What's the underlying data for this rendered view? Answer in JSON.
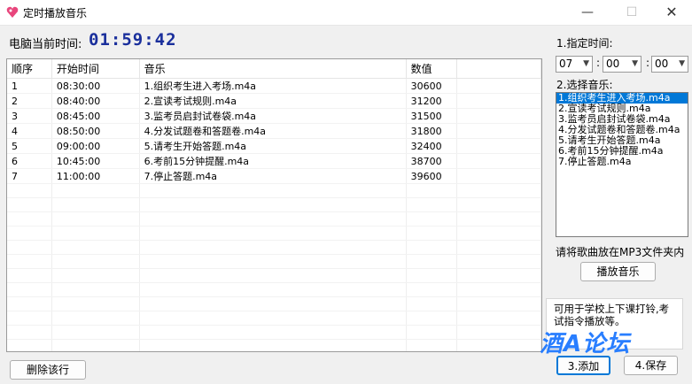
{
  "window": {
    "title": "定时播放音乐",
    "minimize": "—",
    "maximize": "☐",
    "close": "✕"
  },
  "clock": {
    "label": "电脑当前时间:",
    "value": "01:59:42"
  },
  "table": {
    "columns": [
      "顺序",
      "开始时间",
      "音乐",
      "数值",
      ""
    ],
    "rows": [
      [
        "1",
        "08:30:00",
        "1.组织考生进入考场.m4a",
        "30600",
        ""
      ],
      [
        "2",
        "08:40:00",
        "2.宣读考试规则.m4a",
        "31200",
        ""
      ],
      [
        "3",
        "08:45:00",
        "3.监考员启封试卷袋.m4a",
        "31500",
        ""
      ],
      [
        "4",
        "08:50:00",
        "4.分发试题卷和答题卷.m4a",
        "31800",
        ""
      ],
      [
        "5",
        "09:00:00",
        "5.请考生开始答题.m4a",
        "32400",
        ""
      ],
      [
        "6",
        "10:45:00",
        "6.考前15分钟提醒.m4a",
        "38700",
        ""
      ],
      [
        "7",
        "11:00:00",
        "7.停止答题.m4a",
        "39600",
        ""
      ]
    ]
  },
  "buttons": {
    "delete": "删除该行",
    "play": "播放音乐",
    "add": "3.添加",
    "save": "4.保存"
  },
  "time_select": {
    "label": "1.指定时间:",
    "hour": "07",
    "minute": "00",
    "second": "00",
    "separator": ":"
  },
  "music_select": {
    "label": "2.选择音乐:",
    "items": [
      "1.组织考生进入考场.m4a",
      "2.宣读考试规则.m4a",
      "3.监考员启封试卷袋.m4a",
      "4.分发试题卷和答题卷.m4a",
      "5.请考生开始答题.m4a",
      "6.考前15分钟提醒.m4a",
      "7.停止答题.m4a"
    ],
    "selected_index": 0
  },
  "hint": "请将歌曲放在MP3文件夹内",
  "note": "可用于学校上下课打铃,考试指令播放等。",
  "watermark": "酒A论坛",
  "colors": {
    "clock": "#1a2f9c",
    "selection": "#0078d7",
    "watermark": "#1e78ff"
  }
}
